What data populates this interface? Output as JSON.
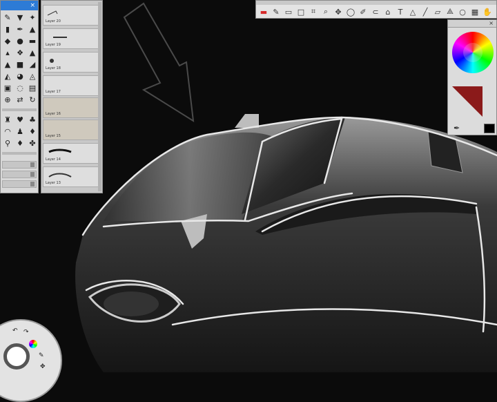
{
  "app": {
    "toolbox_close": "×",
    "color_panel_close": "×"
  },
  "layers": [
    {
      "name": "Layer 20"
    },
    {
      "name": "Layer 19"
    },
    {
      "name": "Layer 18"
    },
    {
      "name": "Layer 17"
    },
    {
      "name": "Layer 16"
    },
    {
      "name": "Layer 15"
    },
    {
      "name": "Layer 14"
    },
    {
      "name": "Layer 13"
    }
  ],
  "colors": {
    "active_color": "#000000",
    "canvas_bg": "#0b0b0b",
    "accent": "#2d7bd6",
    "marker_red": "#d62a2a"
  },
  "icons": {
    "toolbox": [
      "pencil-icon",
      "paint-brush-icon",
      "airbrush-icon",
      "marker-icon",
      "pen-icon",
      "ink-icon",
      "fill-icon",
      "smudge-icon",
      "eraser-icon",
      "blender-icon",
      "glow-icon",
      "chisel-icon",
      "cone-icon",
      "stamp-icon",
      "bucket-icon",
      "drop-icon",
      "water-icon",
      "picker-icon",
      "bag-icon",
      "lasso-icon",
      "image-icon",
      "move-icon",
      "swap-icon",
      "rotate-icon"
    ],
    "toolbox_lower": [
      "chair-icon",
      "cup-icon",
      "lamp-icon",
      "bowl-icon",
      "pawn-icon",
      "ink-bottle-icon",
      "key-icon",
      "pen-nib-icon",
      "stamp-tool-icon"
    ],
    "toptoolbar": [
      "marker-red-icon",
      "pencil-tool-icon",
      "rectangle-icon",
      "square-select-icon",
      "crop-icon",
      "magnifier-icon",
      "move-arrows-icon",
      "ellipse-icon",
      "brush-icon",
      "lasso-tool-icon",
      "warp-icon",
      "text-tool-icon",
      "triangle-icon",
      "line-icon",
      "ruler-icon",
      "perspective-icon",
      "circle-icon",
      "grid-icon",
      "hand-icon",
      "redo-icon"
    ]
  }
}
